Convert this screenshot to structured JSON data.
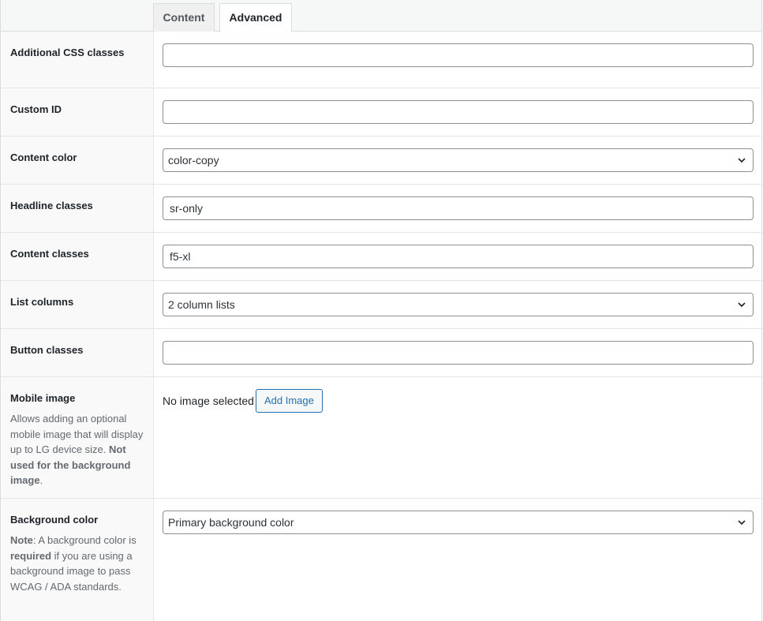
{
  "tabs": [
    {
      "label": "Content",
      "active": false
    },
    {
      "label": "Advanced",
      "active": true
    }
  ],
  "fields": {
    "css_classes": {
      "label": "Additional CSS classes",
      "value": ""
    },
    "custom_id": {
      "label": "Custom ID",
      "value": ""
    },
    "content_color": {
      "label": "Content color",
      "value": "color-copy"
    },
    "headline_classes": {
      "label": "Headline classes",
      "value": "sr-only"
    },
    "content_classes": {
      "label": "Content classes",
      "value": "f5-xl"
    },
    "list_columns": {
      "label": "List columns",
      "value": "2 column lists"
    },
    "button_classes": {
      "label": "Button classes",
      "value": ""
    },
    "mobile_image": {
      "label": "Mobile image",
      "desc_part1": "Allows adding an optional mobile image that will display up to LG device size. ",
      "desc_bold": "Not used for the background image",
      "desc_part2": ".",
      "status": "No image selected",
      "button": "Add Image"
    },
    "background_color": {
      "label": "Background color",
      "note_label": "Note",
      "note_part1": ": A background color is ",
      "note_bold": "required",
      "note_part2": " if you are using a background image to pass WCAG / ADA standards.",
      "value": "Primary background color"
    }
  },
  "colors": {
    "accent": "#2271b1",
    "border": "#8c8f94",
    "label_bg": "#f9f9f9"
  },
  "icons": {
    "select": "chevron-down-icon"
  }
}
